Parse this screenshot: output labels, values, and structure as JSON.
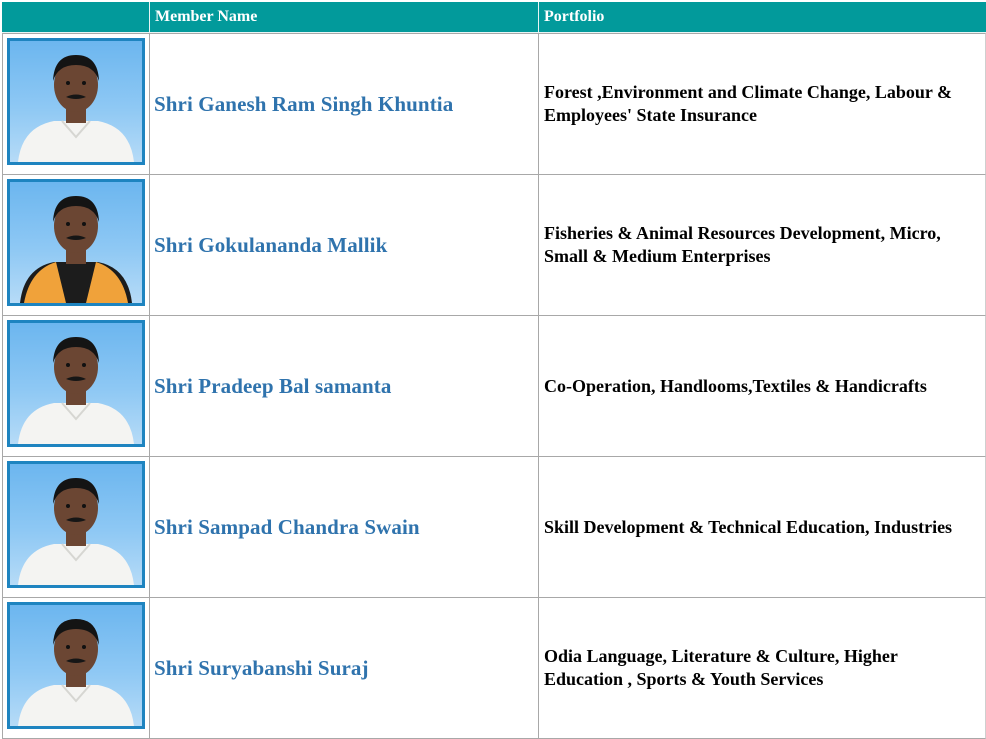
{
  "table": {
    "headers": {
      "photo": "",
      "name": "Member Name",
      "portfolio": "Portfolio"
    },
    "rows": [
      {
        "name": "Shri Ganesh Ram Singh Khuntia",
        "portfolio": "Forest ,Environment and Climate Change, Labour & Employees' State Insurance",
        "photo_icon": "person-photo",
        "attire": "white-kurta"
      },
      {
        "name": "Shri Gokulananda Mallik",
        "portfolio": "Fisheries & Animal Resources Development, Micro, Small & Medium Enterprises",
        "photo_icon": "person-photo",
        "attire": "black-vest-saffron-scarf"
      },
      {
        "name": "Shri Pradeep Bal samanta",
        "portfolio": "Co-Operation, Handlooms,Textiles & Handicrafts",
        "photo_icon": "person-photo",
        "attire": "white-kurta"
      },
      {
        "name": "Shri Sampad Chandra Swain",
        "portfolio": "Skill Development & Technical Education, Industries",
        "photo_icon": "person-photo",
        "attire": "white-shirt"
      },
      {
        "name": "Shri Suryabanshi Suraj",
        "portfolio": "Odia Language, Literature & Culture, Higher Education , Sports & Youth Services",
        "photo_icon": "person-photo",
        "attire": "white-shirt"
      }
    ]
  },
  "colors": {
    "header_bg": "#029a9b",
    "name_link": "#2f73ad",
    "photo_border": "#1e84c0",
    "saffron": "#f0a23a"
  }
}
